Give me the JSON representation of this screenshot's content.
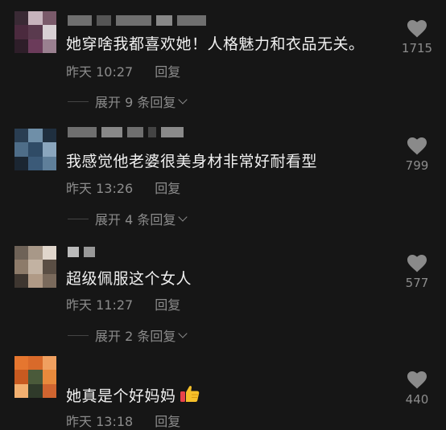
{
  "comments": [
    {
      "text": "她穿啥我都喜欢她！人格魅力和衣品无关。",
      "time": "昨天 10:27",
      "reply": "回复",
      "expand": "展开 9 条回复",
      "likes": "1715",
      "avatar_colors": [
        "#3a2a35",
        "#c7b4bd",
        "#7a5a6a",
        "#4b2a3e",
        "#5a3a4e",
        "#d8d0d4",
        "#2e1e29",
        "#6b3b5a",
        "#9a8090"
      ]
    },
    {
      "text": "我感觉他老婆很美身材非常好耐看型",
      "time": "昨天 13:26",
      "reply": "回复",
      "expand": "展开 4 条回复",
      "likes": "799",
      "avatar_colors": [
        "#2a3e52",
        "#6f8fa8",
        "#1f2f3f",
        "#4e6d88",
        "#2f4b66",
        "#8aa6be",
        "#1b2632",
        "#3b5a78",
        "#5f7f9a"
      ]
    },
    {
      "text": "超级佩服这个女人",
      "time": "昨天 11:27",
      "reply": "回复",
      "expand": "展开 2 条回复",
      "likes": "577",
      "avatar_colors": [
        "#6e6257",
        "#a89888",
        "#e0d6cc",
        "#8d7b6a",
        "#c2b2a2",
        "#5a4e44",
        "#3e3630",
        "#b09a86",
        "#7a6a5c"
      ]
    },
    {
      "text": "她真是个好妈妈",
      "time": "昨天 13:18",
      "reply": "回复",
      "likes": "440",
      "avatar_colors": [
        "#e5762f",
        "#d96a2a",
        "#f0a060",
        "#c85a20",
        "#4a5a3a",
        "#e88a3c",
        "#f2b070",
        "#2f3a2a",
        "#d06530"
      ]
    }
  ]
}
